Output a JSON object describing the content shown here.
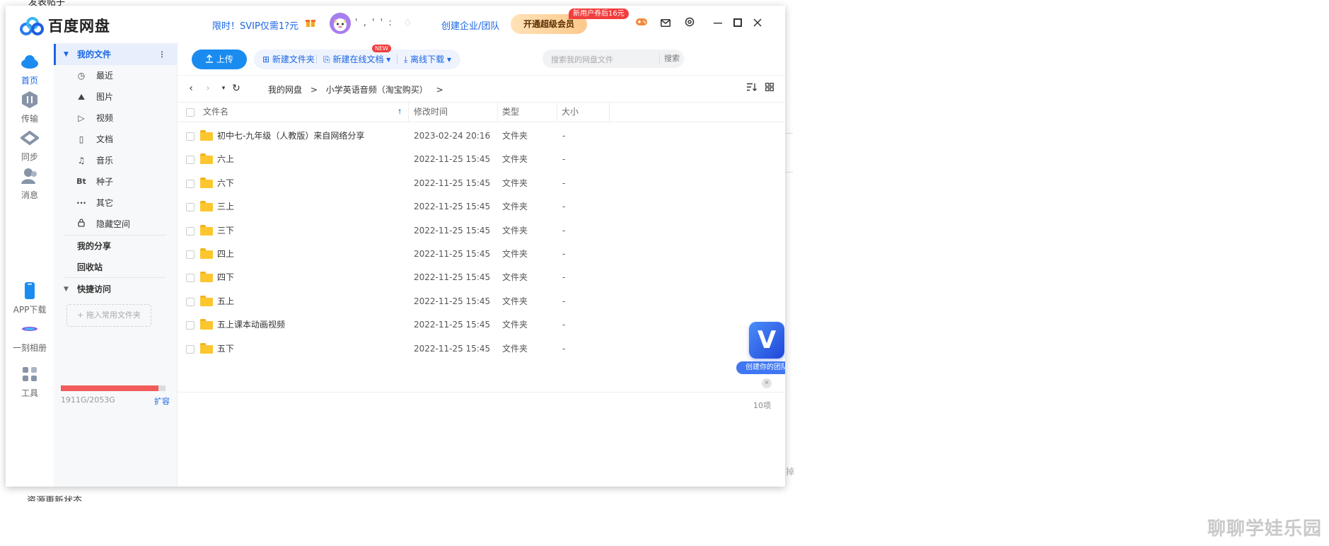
{
  "app": {
    "name": "百度网盘"
  },
  "header": {
    "promo_text": "限时！SVIP仅需1?元",
    "username": "'  ,  '  '  :",
    "team_link": "创建企业/团队",
    "svip_button": "开通超级会员",
    "svip_tag": "新用户券后16元",
    "icons": [
      "game-icon",
      "mail-icon",
      "settings-icon",
      "minimize-icon",
      "maximize-icon",
      "close-icon"
    ]
  },
  "rail": {
    "items": [
      {
        "label": "首页",
        "icon": "cloud-icon",
        "active": true
      },
      {
        "label": "传输",
        "icon": "transfer-icon",
        "active": false
      },
      {
        "label": "同步",
        "icon": "sync-icon",
        "active": false
      },
      {
        "label": "消息",
        "icon": "message-icon",
        "active": false
      }
    ],
    "bottom": [
      {
        "label": "APP下载",
        "icon": "phone-icon"
      },
      {
        "label": "一刻相册",
        "icon": "album-icon"
      },
      {
        "label": "工具",
        "icon": "tools-icon"
      }
    ]
  },
  "sidebar": {
    "my_files": "我的文件",
    "items": [
      {
        "label": "最近",
        "icon": "clock-icon",
        "glyph": "◷"
      },
      {
        "label": "图片",
        "icon": "image-icon",
        "glyph": "⛰"
      },
      {
        "label": "视频",
        "icon": "video-icon",
        "glyph": "▷"
      },
      {
        "label": "文档",
        "icon": "document-icon",
        "glyph": "▯"
      },
      {
        "label": "音乐",
        "icon": "music-icon",
        "glyph": "♫"
      },
      {
        "label": "种子",
        "icon": "bt-icon",
        "glyph": "Bt"
      },
      {
        "label": "其它",
        "icon": "more-icon",
        "glyph": "···"
      },
      {
        "label": "隐藏空间",
        "icon": "lock-icon",
        "glyph": "🔒"
      }
    ],
    "my_share": "我的分享",
    "recycle": "回收站",
    "quick_access": "快捷访问",
    "dropzone": "+ 拖入常用文件夹",
    "quota": "1911G/2053G",
    "quota_used_fraction": 0.93,
    "expand": "扩容"
  },
  "toolbar": {
    "upload": "上传",
    "new_folder": "新建文件夹",
    "new_doc": "新建在线文档",
    "new_badge": "NEW",
    "offline_download": "离线下载",
    "search_placeholder": "搜索我的网盘文件",
    "search_button": "搜索"
  },
  "breadcrumb": [
    "我的网盘",
    ">",
    "小学英语音频（淘宝购买）",
    ">"
  ],
  "table": {
    "headers": {
      "name": "文件名",
      "modified": "修改时间",
      "type": "类型",
      "size": "大小"
    },
    "rows": [
      {
        "name": "初中七-九年级（人教版）来自网络分享",
        "modified": "2023-02-24 20:16",
        "type": "文件夹",
        "size": "-"
      },
      {
        "name": "六上",
        "modified": "2022-11-25 15:45",
        "type": "文件夹",
        "size": "-"
      },
      {
        "name": "六下",
        "modified": "2022-11-25 15:45",
        "type": "文件夹",
        "size": "-"
      },
      {
        "name": "三上",
        "modified": "2022-11-25 15:45",
        "type": "文件夹",
        "size": "-"
      },
      {
        "name": "三下",
        "modified": "2022-11-25 15:45",
        "type": "文件夹",
        "size": "-"
      },
      {
        "name": "四上",
        "modified": "2022-11-25 15:45",
        "type": "文件夹",
        "size": "-"
      },
      {
        "name": "四下",
        "modified": "2022-11-25 15:45",
        "type": "文件夹",
        "size": "-"
      },
      {
        "name": "五上",
        "modified": "2022-11-25 15:45",
        "type": "文件夹",
        "size": "-"
      },
      {
        "name": "五上课本动画视频",
        "modified": "2022-11-25 15:45",
        "type": "文件夹",
        "size": "-"
      },
      {
        "name": "五下",
        "modified": "2022-11-25 15:45",
        "type": "文件夹",
        "size": "-"
      }
    ],
    "count": "10项"
  },
  "promo_float": {
    "letter": "V",
    "label": "创建你的团队"
  },
  "background": {
    "frag_top": "发表帖子",
    "frag_bottom": "资源更新状态",
    "frag_right": "掉",
    "watermark": "聊聊学娃乐园"
  },
  "colors": {
    "accent": "#1a66e6",
    "upload": "#1a8cf0",
    "quota": "#f25b5b",
    "folder": "#fcc62e"
  }
}
